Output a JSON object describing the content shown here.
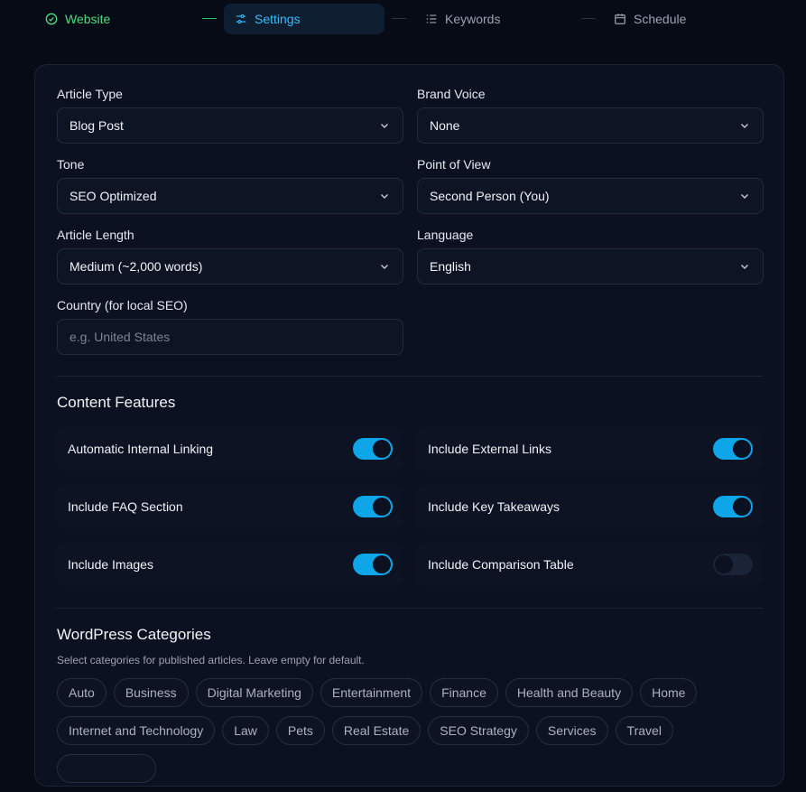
{
  "stepper": {
    "steps": [
      {
        "label": "Website",
        "state": "completed"
      },
      {
        "label": "Settings",
        "state": "active"
      },
      {
        "label": "Keywords",
        "state": "pending"
      },
      {
        "label": "Schedule",
        "state": "pending"
      }
    ]
  },
  "settings": {
    "article_type": {
      "label": "Article Type",
      "value": "Blog Post"
    },
    "brand_voice": {
      "label": "Brand Voice",
      "value": "None"
    },
    "tone": {
      "label": "Tone",
      "value": "SEO Optimized"
    },
    "point_of_view": {
      "label": "Point of View",
      "value": "Second Person (You)"
    },
    "article_length": {
      "label": "Article Length",
      "value": "Medium (~2,000 words)"
    },
    "language": {
      "label": "Language",
      "value": "English"
    },
    "country": {
      "label": "Country (for local SEO)",
      "value": "",
      "placeholder": "e.g. United States"
    }
  },
  "features": {
    "title": "Content Features",
    "items": [
      {
        "label": "Automatic Internal Linking",
        "enabled": true
      },
      {
        "label": "Include External Links",
        "enabled": true
      },
      {
        "label": "Include FAQ Section",
        "enabled": true
      },
      {
        "label": "Include Key Takeaways",
        "enabled": true
      },
      {
        "label": "Include Images",
        "enabled": true
      },
      {
        "label": "Include Comparison Table",
        "enabled": false
      }
    ]
  },
  "categories": {
    "title": "WordPress Categories",
    "description": "Select categories for published articles. Leave empty for default.",
    "items": [
      "Auto",
      "Business",
      "Digital Marketing",
      "Entertainment",
      "Finance",
      "Health and Beauty",
      "Home",
      "Internet and Technology",
      "Law",
      "Pets",
      "Real Estate",
      "SEO Strategy",
      "Services",
      "Travel"
    ]
  },
  "colors": {
    "accent": "#0ea5e9",
    "success": "#4ade80",
    "background": "#070b15",
    "card": "#0b1120"
  },
  "icons": {
    "website": "check-circle-icon",
    "settings": "sliders-icon",
    "keywords": "list-icon",
    "schedule": "calendar-icon",
    "select": "chevron-down-icon"
  }
}
